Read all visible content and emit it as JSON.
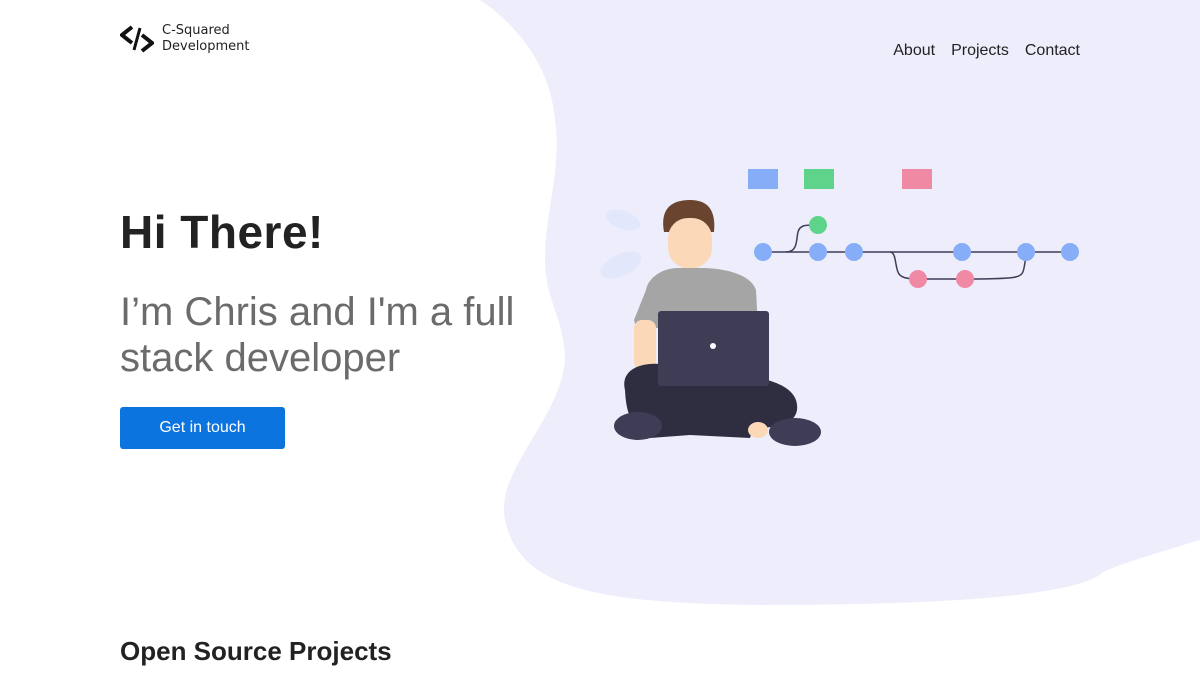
{
  "brand": {
    "line1": "C-Squared",
    "line2": "Development",
    "icon": "code-brackets-logo-icon"
  },
  "nav": {
    "items": [
      {
        "label": "About"
      },
      {
        "label": "Projects"
      },
      {
        "label": "Contact"
      }
    ]
  },
  "hero": {
    "title": "Hi There!",
    "subtitle": "I’m Chris and I'm a full stack developer",
    "cta_label": "Get in touch",
    "illustration": "developer-with-laptop-git-branches-illustration"
  },
  "sections": {
    "projects_title": "Open Source Projects"
  },
  "colors": {
    "accent": "#0b74de",
    "blob": "#eeedfc",
    "node_blue": "#86aef8",
    "node_green": "#5ed48a",
    "node_pink": "#f08aa4",
    "laptop": "#3f3d56"
  }
}
